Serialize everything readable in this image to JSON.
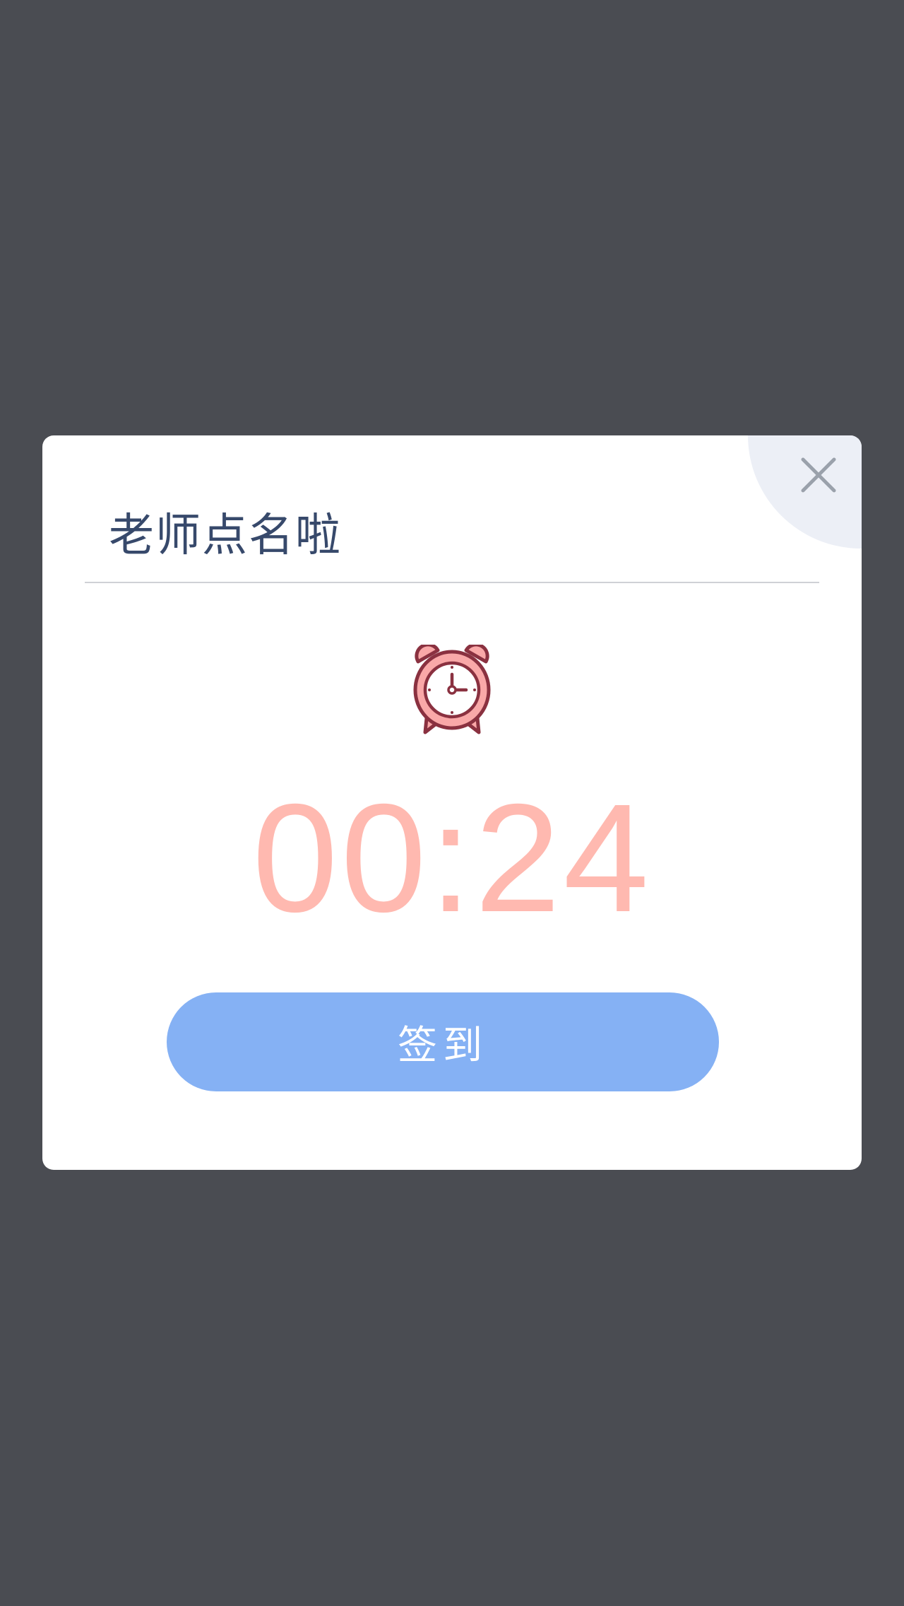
{
  "dialog": {
    "title": "老师点名啦",
    "countdown": "00:24",
    "checkin_label": "签到",
    "icons": {
      "close": "close-icon",
      "timer": "alarm-clock-icon"
    }
  },
  "colors": {
    "backdrop": "#4a4c52",
    "title": "#37496b",
    "countdown": "#ffb9b0",
    "button": "#85b1f4",
    "close_corner": "#eceff6",
    "clock_outline": "#8a3140",
    "clock_fill": "#f9a8a8"
  }
}
